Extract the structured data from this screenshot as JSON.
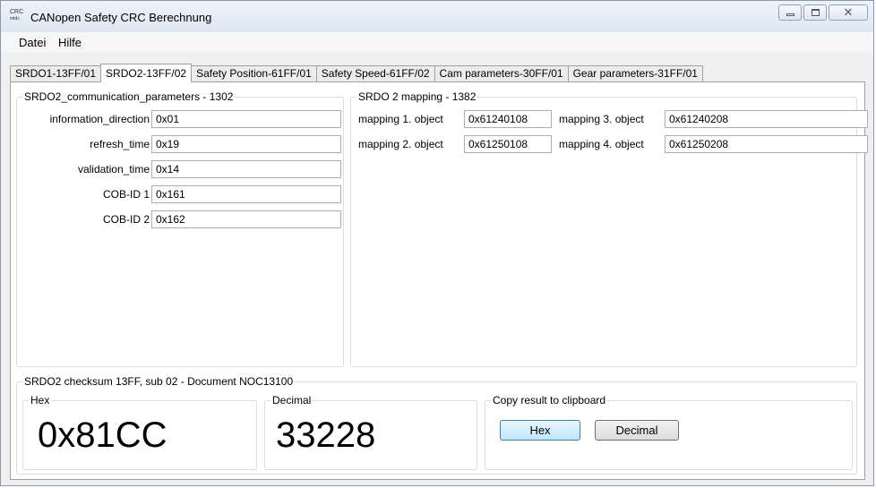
{
  "window": {
    "title": "CANopen Safety CRC Berechnung",
    "icon_text": "CRC",
    "icon_subtext": "mtdc",
    "icon": "crc-app-icon"
  },
  "menu": {
    "datei": "Datei",
    "hilfe": "Hilfe"
  },
  "tabs": [
    {
      "label": "SRDO1-13FF/01"
    },
    {
      "label": "SRDO2-13FF/02",
      "active": true
    },
    {
      "label": "Safety Position-61FF/01"
    },
    {
      "label": "Safety Speed-61FF/02"
    },
    {
      "label": "Cam parameters-30FF/01"
    },
    {
      "label": "Gear parameters-31FF/01"
    }
  ],
  "comm": {
    "caption": "SRDO2_communication_parameters - 1302",
    "fields": [
      {
        "label": "information_direction",
        "value": "0x01"
      },
      {
        "label": "refresh_time",
        "value": "0x19"
      },
      {
        "label": "validation_time",
        "value": "0x14"
      },
      {
        "label": "COB-ID 1",
        "value": "0x161"
      },
      {
        "label": "COB-ID 2",
        "value": "0x162"
      }
    ]
  },
  "mapping": {
    "caption": "SRDO 2 mapping - 1382",
    "items": [
      {
        "label": "mapping 1. object",
        "value": "0x61240108"
      },
      {
        "label": "mapping 2. object",
        "value": "0x61250108"
      },
      {
        "label": "mapping 3. object",
        "value": "0x61240208"
      },
      {
        "label": "mapping 4. object",
        "value": "0x61250208"
      }
    ]
  },
  "checksum": {
    "caption": "SRDO2 checksum 13FF, sub 02 - Document NOC13100",
    "hex_label": "Hex",
    "hex_value": "0x81CC",
    "decimal_label": "Decimal",
    "decimal_value": "33228",
    "copy_label": "Copy result to clipboard",
    "hex_button": "Hex",
    "decimal_button": "Decimal"
  }
}
